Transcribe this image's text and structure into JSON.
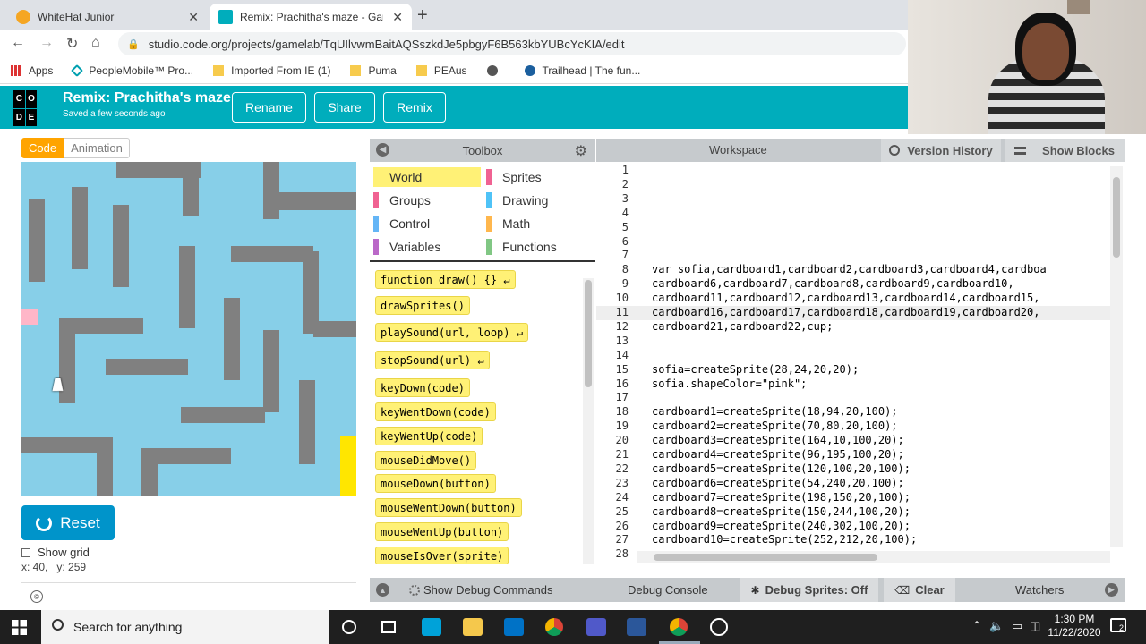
{
  "browser": {
    "tabs": [
      {
        "title": "WhiteHat Junior",
        "active": false
      },
      {
        "title": "Remix: Prachitha's maze - Game",
        "active": true
      }
    ],
    "url": "studio.code.org/projects/gamelab/TqUIlvwmBaitAQSszkdJe5pbgyF6B563kbYUBcYcKIA/edit",
    "bookmarks": [
      "Apps",
      "PeopleMobile™ Pro...",
      "Imported From IE (1)",
      "Puma",
      "PEAus",
      "",
      "Trailhead | The fun..."
    ]
  },
  "header": {
    "logo_letters": [
      "C",
      "O",
      "",
      "D",
      "E",
      ""
    ],
    "project_title": "Remix: Prachitha's maze",
    "saved_status": "Saved a few seconds ago",
    "buttons": {
      "rename": "Rename",
      "share": "Share",
      "remix": "Remix"
    }
  },
  "left_panel": {
    "code_tab": "Code",
    "animation_tab": "Animation",
    "reset_label": "Reset",
    "show_grid_label": "Show grid",
    "coordinates": "x: 40,   y: 259",
    "cc_label": "©"
  },
  "colors": {
    "brand": "#00adbc",
    "maze_bg": "#87cfe8",
    "wall": "#808080",
    "player": "#ffb6c8",
    "goal": "#ffe600",
    "block": "#fff176"
  },
  "toolbox": {
    "title": "Toolbox",
    "categories": [
      {
        "label": "World",
        "color": "#fff176",
        "selected": true
      },
      {
        "label": "Sprites",
        "color": "#f06292"
      },
      {
        "label": "Groups",
        "color": "#f06292"
      },
      {
        "label": "Drawing",
        "color": "#4fc3f7"
      },
      {
        "label": "Control",
        "color": "#64b5f6"
      },
      {
        "label": "Math",
        "color": "#ffb74d"
      },
      {
        "label": "Variables",
        "color": "#ba68c8"
      },
      {
        "label": "Functions",
        "color": "#81c784"
      }
    ],
    "blocks": [
      "function draw() {} ↵",
      "drawSprites()",
      "playSound(url, loop) ↵",
      "stopSound(url) ↵",
      "keyDown(code)",
      "keyWentDown(code)",
      "keyWentUp(code)",
      "mouseDidMove()",
      "mouseDown(button)",
      "mouseWentDown(button)",
      "mouseWentUp(button)",
      "mouseIsOver(sprite)"
    ]
  },
  "workspace": {
    "title": "Workspace",
    "version_history": "Version History",
    "show_blocks": "Show Blocks",
    "lines": [
      {
        "n": "1",
        "code": ""
      },
      {
        "n": "2",
        "code": ""
      },
      {
        "n": "3",
        "code": ""
      },
      {
        "n": "4",
        "code": ""
      },
      {
        "n": "5",
        "code": ""
      },
      {
        "n": "6",
        "code": ""
      },
      {
        "n": "7",
        "code": ""
      },
      {
        "n": "8",
        "code": "var sofia,cardboard1,cardboard2,cardboard3,cardboard4,cardboa"
      },
      {
        "n": "9",
        "code": "cardboard6,cardboard7,cardboard8,cardboard9,cardboard10,"
      },
      {
        "n": "10",
        "code": "cardboard11,cardboard12,cardboard13,cardboard14,cardboard15,"
      },
      {
        "n": "11",
        "code": "cardboard16,cardboard17,cardboard18,cardboard19,cardboard20,"
      },
      {
        "n": "12",
        "code": "cardboard21,cardboard22,cup;"
      },
      {
        "n": "13",
        "code": ""
      },
      {
        "n": "14",
        "code": ""
      },
      {
        "n": "15",
        "code": "sofia=createSprite(28,24,20,20);"
      },
      {
        "n": "16",
        "code": "sofia.shapeColor=\"pink\";"
      },
      {
        "n": "17",
        "code": ""
      },
      {
        "n": "18",
        "code": "cardboard1=createSprite(18,94,20,100);"
      },
      {
        "n": "19",
        "code": "cardboard2=createSprite(70,80,20,100);"
      },
      {
        "n": "20",
        "code": "cardboard3=createSprite(164,10,100,20);"
      },
      {
        "n": "21",
        "code": "cardboard4=createSprite(96,195,100,20);"
      },
      {
        "n": "22",
        "code": "cardboard5=createSprite(120,100,20,100);"
      },
      {
        "n": "23",
        "code": "cardboard6=createSprite(54,240,20,100);"
      },
      {
        "n": "24",
        "code": "cardboard7=createSprite(198,150,20,100);"
      },
      {
        "n": "25",
        "code": "cardboard8=createSprite(150,244,100,20);"
      },
      {
        "n": "26",
        "code": "cardboard9=createSprite(240,302,100,20);"
      },
      {
        "n": "27",
        "code": "cardboard10=createSprite(252,212,20,100);"
      },
      {
        "n": "28",
        "code": ""
      }
    ]
  },
  "bottom_bar": {
    "show_debug": "Show Debug Commands",
    "debug_console": "Debug Console",
    "debug_sprites": "Debug Sprites: Off",
    "clear": "Clear",
    "watchers": "Watchers"
  },
  "taskbar": {
    "search_placeholder": "Search for anything",
    "time": "1:30 PM",
    "date": "11/22/2020",
    "notifications": "2"
  }
}
